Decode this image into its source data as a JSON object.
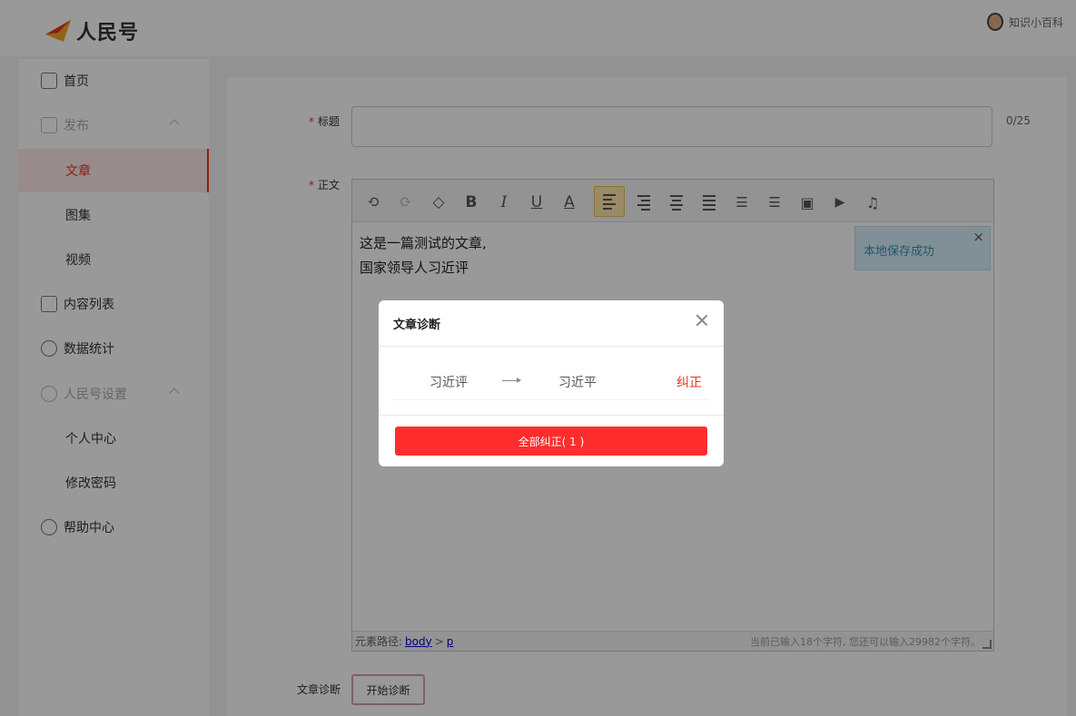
{
  "header": {
    "logo_text": "人民号",
    "user_name": "知识小百科"
  },
  "sidebar": {
    "home": "首页",
    "publish": "发布",
    "publish_items": [
      "文章",
      "图集",
      "视频"
    ],
    "content_list": "内容列表",
    "stats": "数据统计",
    "settings": "人民号设置",
    "settings_items": [
      "个人中心",
      "修改密码"
    ],
    "help": "帮助中心"
  },
  "form": {
    "title_label": "标题",
    "title_counter": "0/25",
    "body_label": "正文",
    "required_mark": "*",
    "content_lines": [
      "这是一篇测试的文章,",
      "国家领导人习近评"
    ],
    "status_path_label": "元素路径:",
    "status_path_body": "body",
    "status_path_sep": ">",
    "status_path_p": "p",
    "status_count": "当前已输入18个字符, 您还可以输入29982个字符。",
    "diagnose_label": "文章诊断",
    "diagnose_button": "开始诊断"
  },
  "toolbar": {
    "bold": "B",
    "italic": "I",
    "underline": "U",
    "font_color": "A"
  },
  "toast": {
    "message": "本地保存成功",
    "close": "×"
  },
  "modal": {
    "title": "文章诊断",
    "wrong_word": "习近评",
    "right_word": "习近平",
    "fix_label": "纠正",
    "fix_all_label": "全部纠正( 1 )"
  },
  "colors": {
    "accent": "#e8341c",
    "fix_all_bg": "#ff2d2d",
    "toast_bg": "#d8f0fa"
  }
}
